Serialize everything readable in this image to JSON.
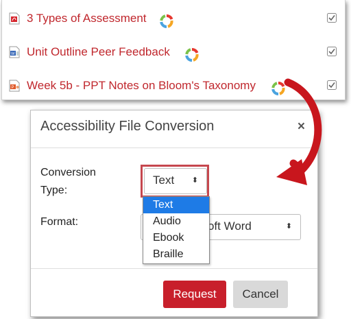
{
  "files": [
    {
      "name": "3 Types of Assessment",
      "type": "pdf"
    },
    {
      "name": "Unit Outline Peer Feedback",
      "type": "word"
    },
    {
      "name": "Week 5b - PPT Notes on Bloom's Taxonomy",
      "type": "powerpoint"
    }
  ],
  "dialog": {
    "title": "Accessibility File Conversion",
    "close": "×",
    "conversion_type_label_line1": "Conversion",
    "conversion_type_label_line2": "Type:",
    "conversion_type_value": "Text",
    "format_label": "Format:",
    "format_value_visible": "osoft Word",
    "caret": "⬍",
    "options": [
      "Text",
      "Audio",
      "Ebook",
      "Braille"
    ],
    "request_label": "Request",
    "cancel_label": "Cancel"
  },
  "colors": {
    "link": "#c0272d",
    "highlight_border": "#c6474e",
    "selected_option": "#1e7be6",
    "request_button": "#c81f2b",
    "arrow": "#c8161d"
  }
}
